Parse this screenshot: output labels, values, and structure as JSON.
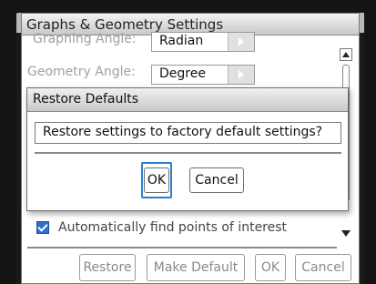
{
  "window": {
    "title": "Graphs & Geometry Settings"
  },
  "settings": {
    "graphing_angle": {
      "label": "Graphing Angle:",
      "value": "Radian"
    },
    "geometry_angle": {
      "label": "Geometry Angle:",
      "value": "Degree"
    },
    "auto_points": {
      "label": "Automatically find points of interest",
      "checked": true
    }
  },
  "footer": {
    "restore_label": "Restore",
    "make_default_label": "Make Default",
    "ok_label": "OK",
    "cancel_label": "Cancel"
  },
  "modal": {
    "title": "Restore Defaults",
    "message": "Restore settings to factory default settings?",
    "ok_label": "OK",
    "cancel_label": "Cancel"
  },
  "colors": {
    "focus": "#2a7fd0",
    "checkbox": "#2f6fd0",
    "disabled_text": "#8a8a8a"
  }
}
